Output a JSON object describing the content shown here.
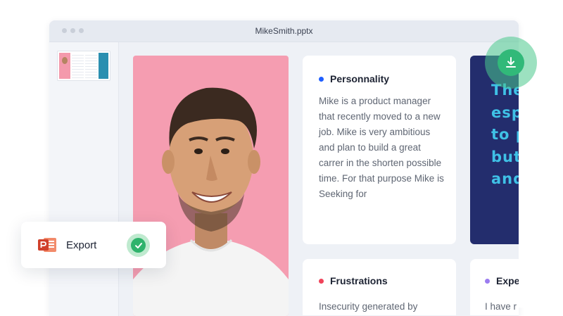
{
  "window": {
    "title": "MikeSmith.pptx"
  },
  "slide": {
    "personality": {
      "title": "Personnality",
      "bullet_color": "#1f5eff",
      "text": "Mike is a product manager that recently moved to a new job. Mike is very ambitious and plan to build a great carrer in the shorten possible time. For that purpose Mike is Seeking for"
    },
    "frustrations": {
      "title": "Frustrations",
      "bullet_color": "#f0435a",
      "text": "Insecurity generated by"
    },
    "expectations": {
      "title": "Expe",
      "bullet_color": "#9b7cf0",
      "text": "I have r"
    },
    "quote_lines": [
      "The",
      "esp",
      "to p",
      "but",
      "and"
    ]
  },
  "export": {
    "label": "Export",
    "status_icon": "check-icon"
  },
  "download_button": {
    "icon": "download-icon"
  },
  "colors": {
    "accent_green": "#31b979",
    "navy": "#232d6d",
    "quote_cyan": "#3fc1e6",
    "photo_bg": "#f59db1"
  }
}
